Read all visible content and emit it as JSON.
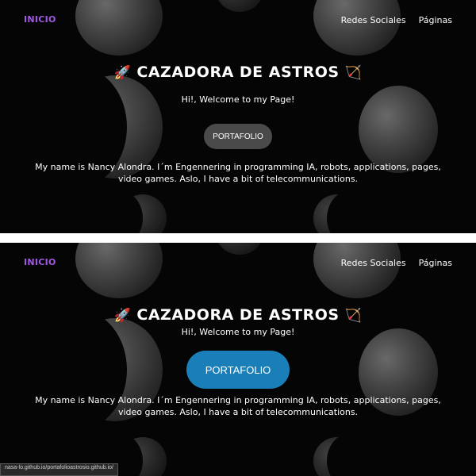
{
  "nav": {
    "home": "INICIO",
    "links": [
      "Redes Sociales",
      "Páginas"
    ]
  },
  "hero": {
    "title": "CAZADORA DE ASTROS",
    "icon_left": "🚀",
    "icon_right": "🏹",
    "welcome": "Hi!, Welcome to my Page!",
    "button_label": "PORTAFOLIO",
    "bio": "My name is Nancy Alondra. I´m Engennering in programming IA, robots, applications, pages, video games. Aslo, I have a bit of telecommunications."
  },
  "status_bar": {
    "url": "nasa-lo.github.io/portafolioastrosio.github.io/"
  },
  "colors": {
    "accent": "#a259e6",
    "button_default": "#4a4a4a",
    "button_hover": "#1a7fb8",
    "background": "#050505"
  }
}
